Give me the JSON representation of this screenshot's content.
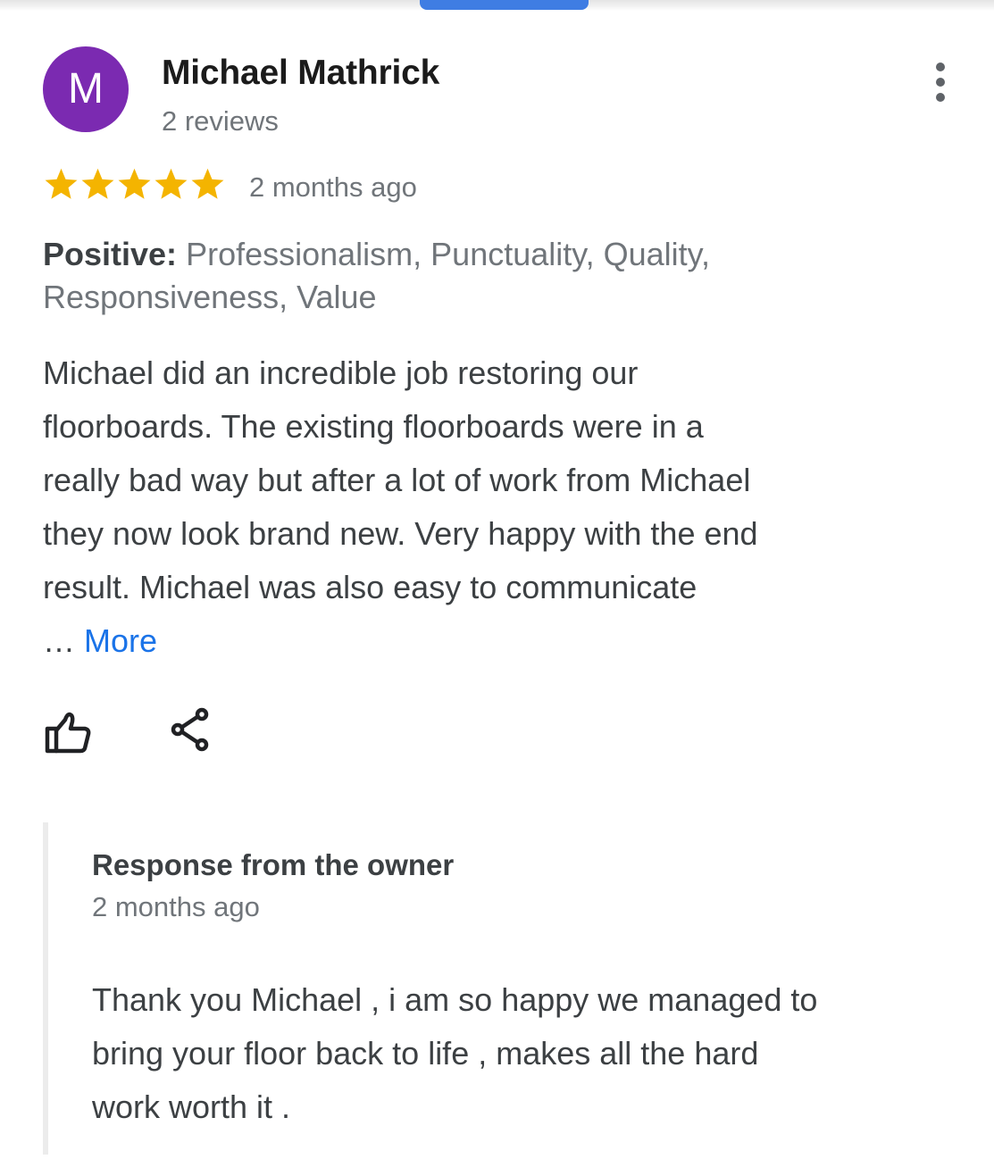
{
  "review": {
    "author": {
      "initial": "M",
      "name": "Michael Mathrick",
      "review_count": "2 reviews",
      "avatar_color": "#7b2ab1"
    },
    "rating": {
      "stars": 5,
      "max_stars": 5,
      "star_color": "#f4b400"
    },
    "date": "2 months ago",
    "positives": {
      "label": "Positive:",
      "text": "Professionalism, Punctuality, Quality,  Responsiveness, Value"
    },
    "body_lines": [
      "Michael did an incredible job restoring our",
      "floorboards. The existing floorboards were in a",
      "really bad way but after a lot of work from Michael",
      "they now look brand new. Very happy with the end",
      "result. Michael was also easy to communicate"
    ],
    "ellipsis": "…",
    "more_label": "More",
    "actions": {
      "like_icon": "thumbs-up-icon",
      "share_icon": "share-icon"
    },
    "menu_icon": "more-vert-icon"
  },
  "owner_response": {
    "title": "Response from the owner",
    "date": "2 months ago",
    "body_lines": [
      "Thank you Michael , i am so happy we managed to",
      "bring your floor back to life , makes all the hard",
      "work worth it ."
    ]
  },
  "colors": {
    "link": "#1a73e8",
    "top_tab": "#3f7de3"
  }
}
